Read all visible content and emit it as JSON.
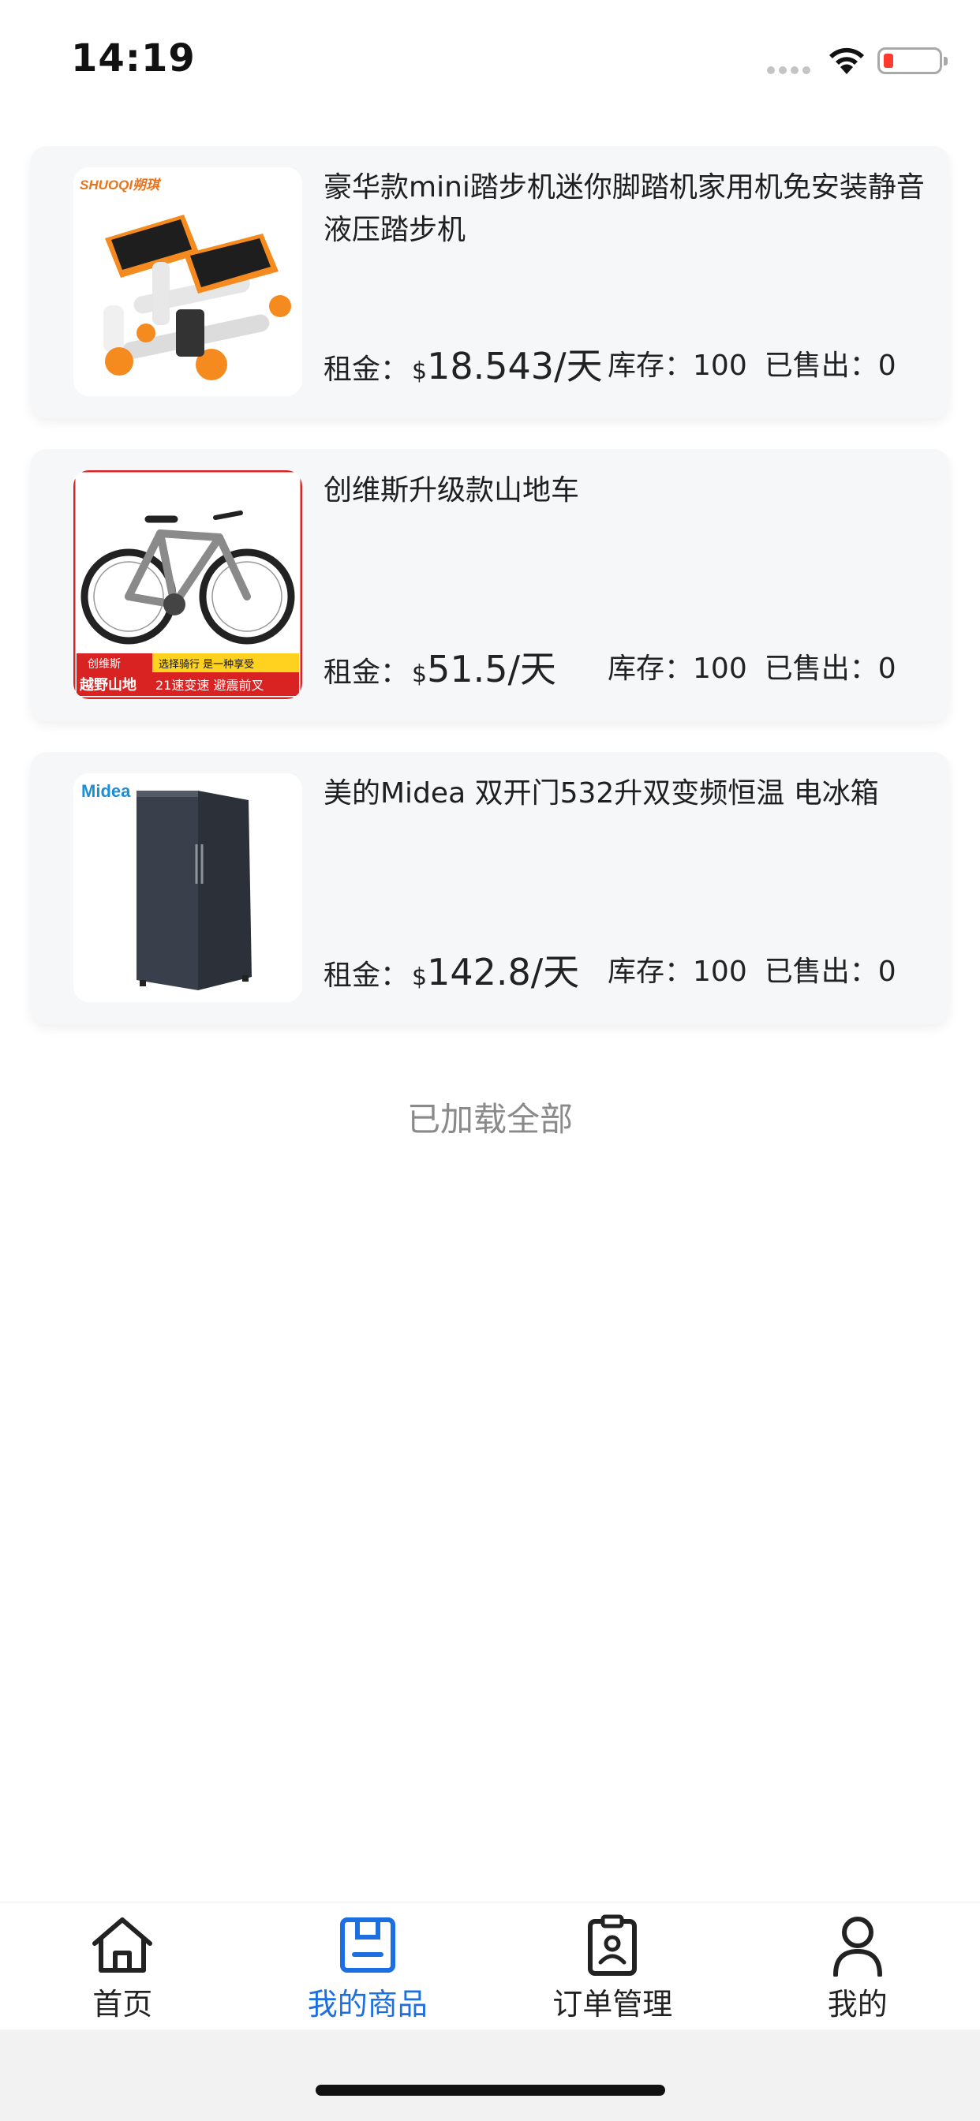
{
  "status_bar": {
    "time": "14:19"
  },
  "labels": {
    "rent": "租金：",
    "currency": "$",
    "stock": "库存：",
    "sold": "已售出："
  },
  "products": [
    {
      "name": "豪华款mini踏步机迷你脚踏机家用机免安装静音液压踏步机",
      "price": "18.543/天",
      "stock": "100",
      "sold": "0",
      "image_brand": "SHUOQI朔琪"
    },
    {
      "name": "创维斯升级款山地车",
      "price": "51.5/天",
      "stock": "100",
      "sold": "0",
      "image_badge": "创维斯",
      "image_caption_1": "越野山地",
      "image_caption_2": "选择骑行  是一种享受",
      "image_caption_3": "21速变速  避震前叉"
    },
    {
      "name": "美的Midea 双开门532升双变频恒温 电冰箱",
      "price": "142.8/天",
      "stock": "100",
      "sold": "0",
      "image_brand": "Midea"
    }
  ],
  "list_footer": "已加载全部",
  "tabs": [
    {
      "label": "首页",
      "icon": "home-icon",
      "active": false
    },
    {
      "label": "我的商品",
      "icon": "product-icon",
      "active": true
    },
    {
      "label": "订单管理",
      "icon": "order-icon",
      "active": false
    },
    {
      "label": "我的",
      "icon": "user-icon",
      "active": false
    }
  ],
  "colors": {
    "accent": "#1b6fe0",
    "card_bg": "#f6f7f9",
    "stepper_orange": "#f58a1f",
    "bike_red": "#d92323"
  }
}
